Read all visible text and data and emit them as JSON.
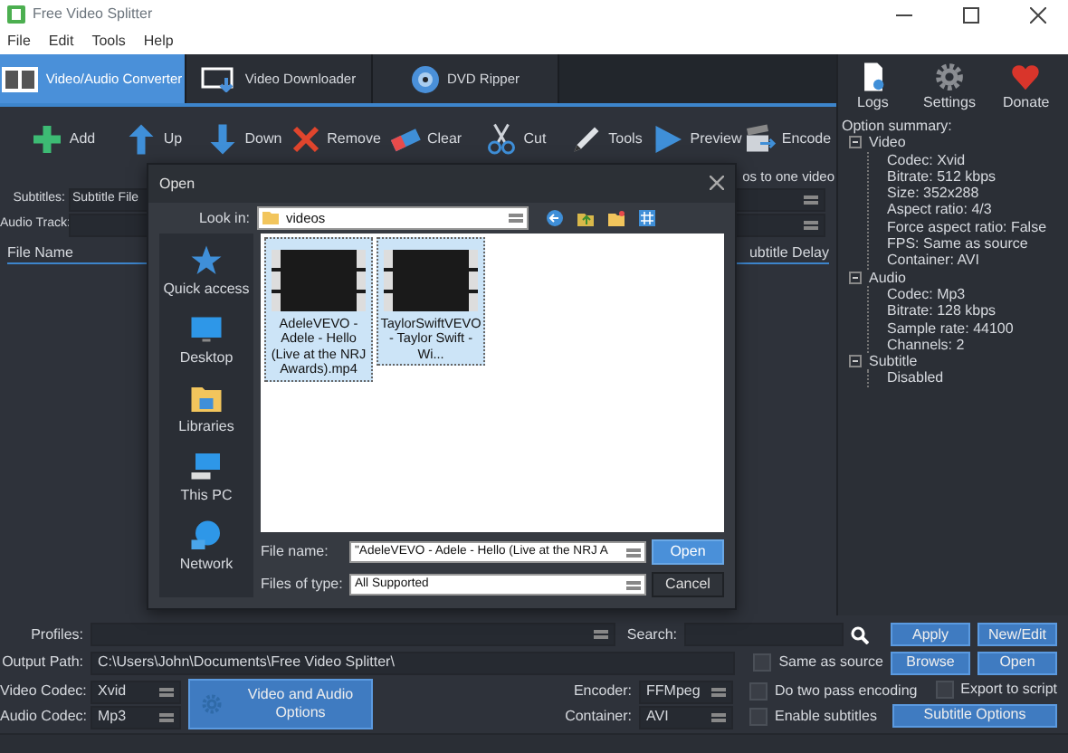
{
  "window": {
    "title": "Free Video Splitter"
  },
  "menu": [
    {
      "label": "File"
    },
    {
      "label": "Edit"
    },
    {
      "label": "Tools"
    },
    {
      "label": "Help"
    }
  ],
  "tabs": [
    {
      "label": "Video/Audio Converter",
      "selected": true
    },
    {
      "label": "Video Downloader",
      "selected": false
    },
    {
      "label": "DVD Ripper",
      "selected": false
    }
  ],
  "top_actions": [
    {
      "label": "Logs"
    },
    {
      "label": "Settings"
    },
    {
      "label": "Donate"
    }
  ],
  "toolbar": [
    {
      "label": "Add"
    },
    {
      "label": "Up"
    },
    {
      "label": "Down"
    },
    {
      "label": "Remove"
    },
    {
      "label": "Clear"
    },
    {
      "label": "Cut"
    },
    {
      "label": "Tools"
    },
    {
      "label": "Preview"
    },
    {
      "label": "Encode"
    }
  ],
  "join_option": {
    "label": "os to one video"
  },
  "subtitles": {
    "label": "Subtitles:",
    "value": "Subtitle File"
  },
  "audio_track": {
    "label": "Audio Track:"
  },
  "file_table": {
    "columns": [
      "File Name",
      "ubtitle Delay"
    ]
  },
  "option_summary": {
    "title": "Option summary:",
    "tree": [
      {
        "label": "Video",
        "expanded": true,
        "children": [
          {
            "label": "Codec: Xvid"
          },
          {
            "label": "Bitrate: 512 kbps"
          },
          {
            "label": "Size: 352x288"
          },
          {
            "label": "Aspect ratio: 4/3"
          },
          {
            "label": "Force aspect ratio: False"
          },
          {
            "label": "FPS: Same as source"
          },
          {
            "label": "Container: AVI"
          }
        ]
      },
      {
        "label": "Audio",
        "expanded": true,
        "children": [
          {
            "label": "Codec: Mp3"
          },
          {
            "label": "Bitrate: 128 kbps"
          },
          {
            "label": "Sample rate: 44100"
          },
          {
            "label": "Channels: 2"
          }
        ]
      },
      {
        "label": "Subtitle",
        "expanded": true,
        "children": [
          {
            "label": "Disabled"
          }
        ]
      }
    ]
  },
  "open_dialog": {
    "title": "Open",
    "look_in_label": "Look in:",
    "look_in_value": "videos",
    "places": [
      {
        "label": "Quick access"
      },
      {
        "label": "Desktop"
      },
      {
        "label": "Libraries"
      },
      {
        "label": "This PC"
      },
      {
        "label": "Network"
      }
    ],
    "files": [
      {
        "name": "AdeleVEVO - Adele - Hello (Live at the NRJ Awards).mp4",
        "selected": true
      },
      {
        "name": "TaylorSwiftVEVO - Taylor Swift - Wi...",
        "selected": true
      }
    ],
    "file_name_label": "File name:",
    "file_name_value": "\"AdeleVEVO - Adele - Hello (Live at the NRJ A",
    "files_of_type_label": "Files of type:",
    "files_of_type_value": "All Supported",
    "buttons": [
      "Open",
      "Cancel"
    ]
  },
  "bottom": {
    "profiles": {
      "label": "Profiles:"
    },
    "search": {
      "label": "Search:"
    },
    "output_path": {
      "label": "Output Path:",
      "value": "C:\\Users\\John\\Documents\\Free Video Splitter\\"
    },
    "video_codec": {
      "label": "Video Codec:",
      "value": "Xvid"
    },
    "audio_codec": {
      "label": "Audio Codec:",
      "value": "Mp3"
    },
    "options_button": "Video and Audio Options",
    "encoder": {
      "label": "Encoder:",
      "value": "FFMpeg"
    },
    "container": {
      "label": "Container:",
      "value": "AVI"
    },
    "checkboxes": [
      {
        "label": "Same as source",
        "checked": false
      },
      {
        "label": "Do two pass encoding",
        "checked": false
      },
      {
        "label": "Enable subtitles",
        "checked": false
      },
      {
        "label": "Export to script",
        "checked": false
      }
    ],
    "buttons": [
      "Apply",
      "New/Edit",
      "Browse",
      "Open"
    ],
    "subtitle_options": "Subtitle Options"
  }
}
